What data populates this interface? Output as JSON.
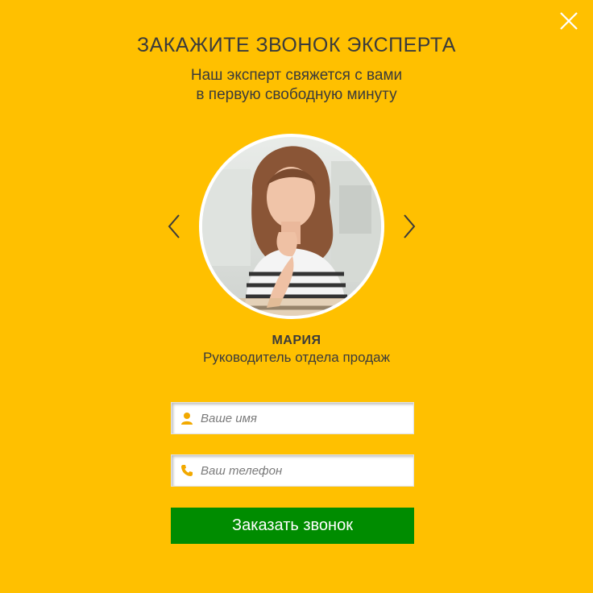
{
  "modal": {
    "title": "ЗАКАЖИТЕ ЗВОНОК ЭКСПЕРТА",
    "subtitle_line1": "Наш эксперт свяжется с вами",
    "subtitle_line2": "в первую свободную минуту"
  },
  "expert": {
    "name": "МАРИЯ",
    "role": "Руководитель отдела продаж"
  },
  "form": {
    "name_placeholder": "Ваше имя",
    "phone_placeholder": "Ваш телефон",
    "submit_label": "Заказать звонок"
  },
  "icons": {
    "close": "close-icon",
    "prev": "chevron-left-icon",
    "next": "chevron-right-icon",
    "user": "user-icon",
    "phone": "phone-icon"
  },
  "colors": {
    "background": "#FFC000",
    "text": "#3b3b3b",
    "button": "#008C00",
    "icon_accent": "#F2A900"
  }
}
